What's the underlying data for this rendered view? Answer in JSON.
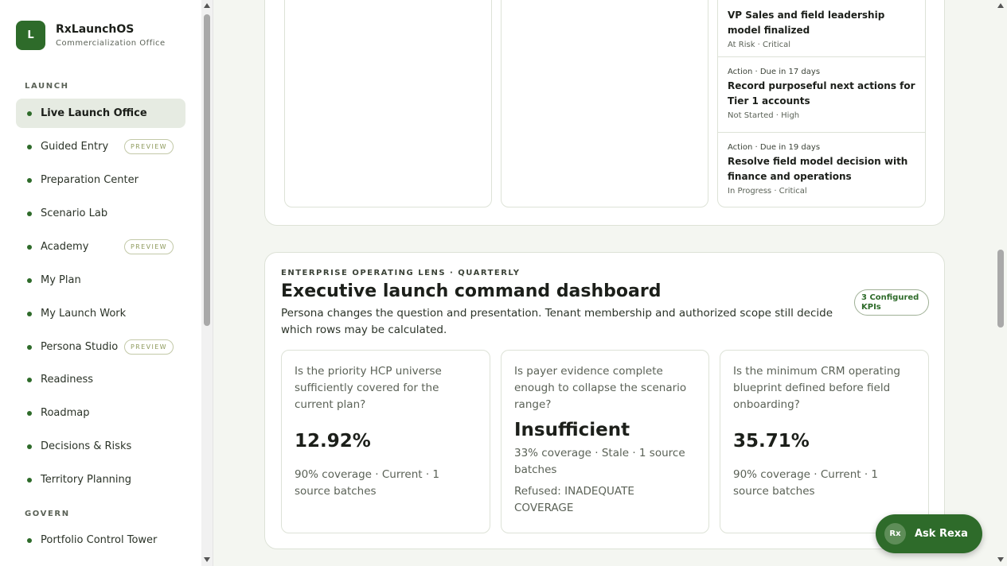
{
  "brand": {
    "logo": "L",
    "name": "RxLaunchOS",
    "subtitle": "Commercialization Office"
  },
  "sidebar": {
    "sections": [
      {
        "label": "LAUNCH"
      },
      {
        "label": "GOVERN"
      }
    ],
    "items": [
      {
        "label": "Live Launch Office",
        "active": true
      },
      {
        "label": "Guided Entry",
        "badge": "PREVIEW"
      },
      {
        "label": "Preparation Center"
      },
      {
        "label": "Scenario Lab"
      },
      {
        "label": "Academy",
        "badge": "PREVIEW"
      },
      {
        "label": "My Plan"
      },
      {
        "label": "My Launch Work"
      },
      {
        "label": "Persona Studio",
        "badge": "PREVIEW"
      },
      {
        "label": "Readiness"
      },
      {
        "label": "Roadmap"
      },
      {
        "label": "Decisions & Risks"
      },
      {
        "label": "Territory Planning"
      },
      {
        "label": "Portfolio Control Tower"
      }
    ]
  },
  "actions": [
    {
      "meta": "",
      "title": "VP Sales and field leadership model finalized",
      "status": "At Risk · Critical"
    },
    {
      "meta": "Action · Due in 17 days",
      "title": "Record purposeful next actions for Tier 1 accounts",
      "status": "Not Started · High"
    },
    {
      "meta": "Action · Due in 19 days",
      "title": "Resolve field model decision with finance and operations",
      "status": "In Progress · Critical"
    }
  ],
  "dashboard": {
    "eyebrow": "ENTERPRISE OPERATING LENS · QUARTERLY",
    "title": "Executive launch command dashboard",
    "description": "Persona changes the question and presentation. Tenant membership and authorized scope still decide which rows may be calculated.",
    "kpi_badge": "3 Configured KPIs",
    "kpis": [
      {
        "question": "Is the priority HCP universe sufficiently covered for the current plan?",
        "value": "12.92%",
        "sub": "90% coverage · Current · 1 source batches",
        "note": ""
      },
      {
        "question": "Is payer evidence complete enough to collapse the scenario range?",
        "value": "Insufficient",
        "sub": "33% coverage · Stale · 1 source batches",
        "note": "Refused: INADEQUATE COVERAGE"
      },
      {
        "question": "Is the minimum CRM operating blueprint defined before field onboarding?",
        "value": "35.71%",
        "sub": "90% coverage · Current · 1 source batches",
        "note": ""
      }
    ]
  },
  "assistant": {
    "avatar": "Rx",
    "label": "Ask Rexa"
  },
  "colors": {
    "accent": "#2e6b2a",
    "active_bg": "#e6ebe2",
    "preview_badge": "#8e9a5c"
  }
}
